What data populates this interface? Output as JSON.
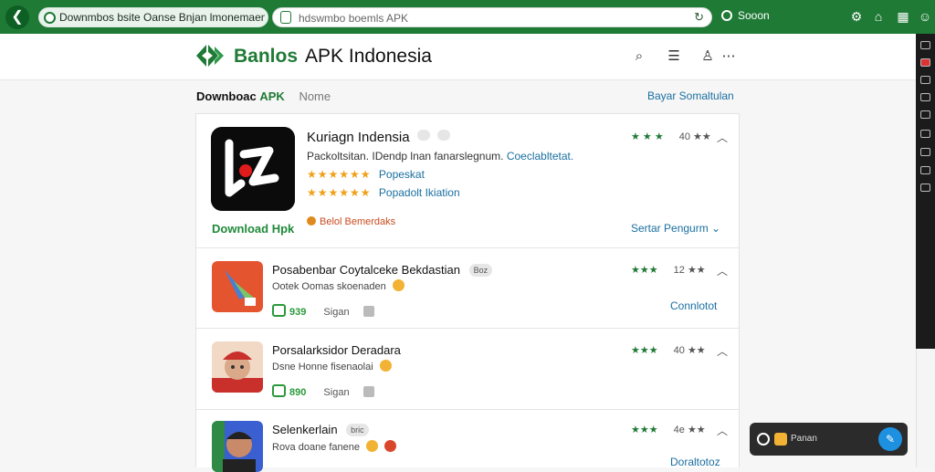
{
  "browser": {
    "tab_title": "Downmbos bsite Oanse Bnjan lmonemaenia",
    "url": "hdswmbo boemls APK",
    "sync_label": "Sooon"
  },
  "site": {
    "brand": "Banlos",
    "brand_sub": "APK Indonesia"
  },
  "breadcrumb": {
    "part1": "Downboac",
    "part2": "APK",
    "part3": "Nome",
    "right_link": "Bayar Somaltulan"
  },
  "featured": {
    "title": "Kuriagn Indensia",
    "desc": "Packoltsitan. IDendp lnan fanarslegnum.",
    "desc_link": "Coeclabltetat.",
    "stars_1": "★★★★★★",
    "stars_1_label": "Popeskat",
    "stars_2": "★★★★★★",
    "stars_2_label": "Popadolt Ikiation",
    "warning": "Belol Bemerdaks",
    "download": "Download Hpk",
    "see_more": "Sertar Pengurm",
    "rating_stars": "★ ★ ★",
    "rating_value": "40 ★★"
  },
  "items": [
    {
      "title": "Posabenbar Coytalceke Bekdastian",
      "tag": "Boz",
      "sub": "Ootek Oomas skoenaden",
      "size": "939",
      "sv": "Sigan",
      "rating_stars": "★★★",
      "rating_value": "12 ★★",
      "link": "Connlotot",
      "color": "#e4542e"
    },
    {
      "title": "Porsalarksidor Deradara",
      "tag": "",
      "sub": "Dsne Honne fisenaolai",
      "size": "890",
      "sv": "Sigan",
      "rating_stars": "★★★",
      "rating_value": "40 ★★",
      "link": "",
      "color": "#c9302c"
    },
    {
      "title": "Selenkerlain",
      "tag": "bric",
      "sub": "Rova doane fanene",
      "size": "",
      "sv": "",
      "rating_stars": "★★★",
      "rating_value": "4e ★★",
      "link": "Doraltotoz",
      "color": "#3a5fd0"
    }
  ],
  "chat": {
    "label": "Panan"
  },
  "colors": {
    "brand": "#1f7a36",
    "link": "#1a6fa0",
    "star": "#f0a019"
  }
}
